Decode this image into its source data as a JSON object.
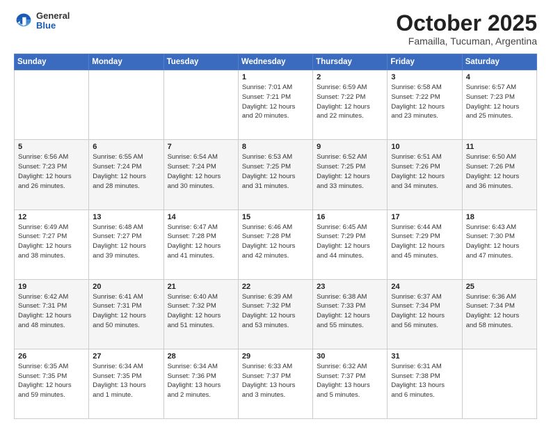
{
  "header": {
    "logo_general": "General",
    "logo_blue": "Blue",
    "title": "October 2025",
    "subtitle": "Famailla, Tucuman, Argentina"
  },
  "weekdays": [
    "Sunday",
    "Monday",
    "Tuesday",
    "Wednesday",
    "Thursday",
    "Friday",
    "Saturday"
  ],
  "weeks": [
    [
      {
        "day": "",
        "info": ""
      },
      {
        "day": "",
        "info": ""
      },
      {
        "day": "",
        "info": ""
      },
      {
        "day": "1",
        "info": "Sunrise: 7:01 AM\nSunset: 7:21 PM\nDaylight: 12 hours\nand 20 minutes."
      },
      {
        "day": "2",
        "info": "Sunrise: 6:59 AM\nSunset: 7:22 PM\nDaylight: 12 hours\nand 22 minutes."
      },
      {
        "day": "3",
        "info": "Sunrise: 6:58 AM\nSunset: 7:22 PM\nDaylight: 12 hours\nand 23 minutes."
      },
      {
        "day": "4",
        "info": "Sunrise: 6:57 AM\nSunset: 7:23 PM\nDaylight: 12 hours\nand 25 minutes."
      }
    ],
    [
      {
        "day": "5",
        "info": "Sunrise: 6:56 AM\nSunset: 7:23 PM\nDaylight: 12 hours\nand 26 minutes."
      },
      {
        "day": "6",
        "info": "Sunrise: 6:55 AM\nSunset: 7:24 PM\nDaylight: 12 hours\nand 28 minutes."
      },
      {
        "day": "7",
        "info": "Sunrise: 6:54 AM\nSunset: 7:24 PM\nDaylight: 12 hours\nand 30 minutes."
      },
      {
        "day": "8",
        "info": "Sunrise: 6:53 AM\nSunset: 7:25 PM\nDaylight: 12 hours\nand 31 minutes."
      },
      {
        "day": "9",
        "info": "Sunrise: 6:52 AM\nSunset: 7:25 PM\nDaylight: 12 hours\nand 33 minutes."
      },
      {
        "day": "10",
        "info": "Sunrise: 6:51 AM\nSunset: 7:26 PM\nDaylight: 12 hours\nand 34 minutes."
      },
      {
        "day": "11",
        "info": "Sunrise: 6:50 AM\nSunset: 7:26 PM\nDaylight: 12 hours\nand 36 minutes."
      }
    ],
    [
      {
        "day": "12",
        "info": "Sunrise: 6:49 AM\nSunset: 7:27 PM\nDaylight: 12 hours\nand 38 minutes."
      },
      {
        "day": "13",
        "info": "Sunrise: 6:48 AM\nSunset: 7:27 PM\nDaylight: 12 hours\nand 39 minutes."
      },
      {
        "day": "14",
        "info": "Sunrise: 6:47 AM\nSunset: 7:28 PM\nDaylight: 12 hours\nand 41 minutes."
      },
      {
        "day": "15",
        "info": "Sunrise: 6:46 AM\nSunset: 7:28 PM\nDaylight: 12 hours\nand 42 minutes."
      },
      {
        "day": "16",
        "info": "Sunrise: 6:45 AM\nSunset: 7:29 PM\nDaylight: 12 hours\nand 44 minutes."
      },
      {
        "day": "17",
        "info": "Sunrise: 6:44 AM\nSunset: 7:29 PM\nDaylight: 12 hours\nand 45 minutes."
      },
      {
        "day": "18",
        "info": "Sunrise: 6:43 AM\nSunset: 7:30 PM\nDaylight: 12 hours\nand 47 minutes."
      }
    ],
    [
      {
        "day": "19",
        "info": "Sunrise: 6:42 AM\nSunset: 7:31 PM\nDaylight: 12 hours\nand 48 minutes."
      },
      {
        "day": "20",
        "info": "Sunrise: 6:41 AM\nSunset: 7:31 PM\nDaylight: 12 hours\nand 50 minutes."
      },
      {
        "day": "21",
        "info": "Sunrise: 6:40 AM\nSunset: 7:32 PM\nDaylight: 12 hours\nand 51 minutes."
      },
      {
        "day": "22",
        "info": "Sunrise: 6:39 AM\nSunset: 7:32 PM\nDaylight: 12 hours\nand 53 minutes."
      },
      {
        "day": "23",
        "info": "Sunrise: 6:38 AM\nSunset: 7:33 PM\nDaylight: 12 hours\nand 55 minutes."
      },
      {
        "day": "24",
        "info": "Sunrise: 6:37 AM\nSunset: 7:34 PM\nDaylight: 12 hours\nand 56 minutes."
      },
      {
        "day": "25",
        "info": "Sunrise: 6:36 AM\nSunset: 7:34 PM\nDaylight: 12 hours\nand 58 minutes."
      }
    ],
    [
      {
        "day": "26",
        "info": "Sunrise: 6:35 AM\nSunset: 7:35 PM\nDaylight: 12 hours\nand 59 minutes."
      },
      {
        "day": "27",
        "info": "Sunrise: 6:34 AM\nSunset: 7:35 PM\nDaylight: 13 hours\nand 1 minute."
      },
      {
        "day": "28",
        "info": "Sunrise: 6:34 AM\nSunset: 7:36 PM\nDaylight: 13 hours\nand 2 minutes."
      },
      {
        "day": "29",
        "info": "Sunrise: 6:33 AM\nSunset: 7:37 PM\nDaylight: 13 hours\nand 3 minutes."
      },
      {
        "day": "30",
        "info": "Sunrise: 6:32 AM\nSunset: 7:37 PM\nDaylight: 13 hours\nand 5 minutes."
      },
      {
        "day": "31",
        "info": "Sunrise: 6:31 AM\nSunset: 7:38 PM\nDaylight: 13 hours\nand 6 minutes."
      },
      {
        "day": "",
        "info": ""
      }
    ]
  ]
}
